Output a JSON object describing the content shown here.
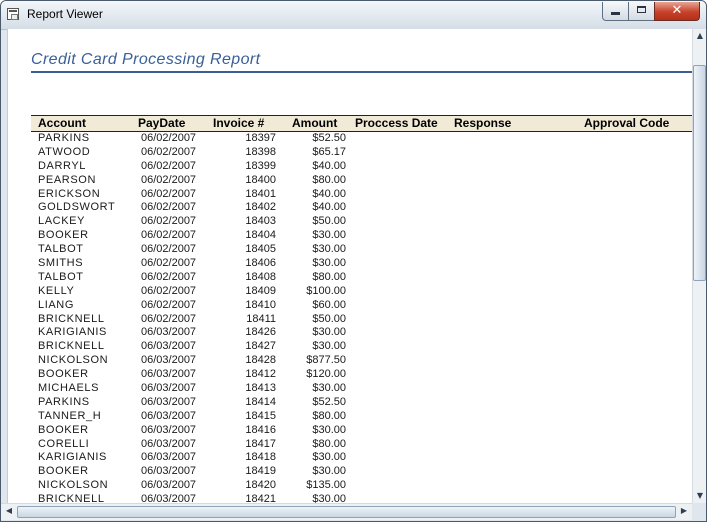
{
  "window": {
    "title": "Report Viewer"
  },
  "report": {
    "title": "Credit Card Processing Report",
    "columns": {
      "account": "Account",
      "paydate": "PayDate",
      "invoice": "Invoice #",
      "amount": "Amount",
      "process_date": "Proccess Date",
      "response": "Response",
      "approval": "Approval Code"
    },
    "rows": [
      [
        "PARKINS",
        "06/02/2007",
        "18397",
        "$52.50"
      ],
      [
        "ATWOOD",
        "06/02/2007",
        "18398",
        "$65.17"
      ],
      [
        "DARRYL",
        "06/02/2007",
        "18399",
        "$40.00"
      ],
      [
        "PEARSON",
        "06/02/2007",
        "18400",
        "$80.00"
      ],
      [
        "ERICKSON",
        "06/02/2007",
        "18401",
        "$40.00"
      ],
      [
        "GOLDSWORT",
        "06/02/2007",
        "18402",
        "$40.00"
      ],
      [
        "LACKEY",
        "06/02/2007",
        "18403",
        "$50.00"
      ],
      [
        "BOOKER",
        "06/02/2007",
        "18404",
        "$30.00"
      ],
      [
        "TALBOT",
        "06/02/2007",
        "18405",
        "$30.00"
      ],
      [
        "SMITHS",
        "06/02/2007",
        "18406",
        "$30.00"
      ],
      [
        "TALBOT",
        "06/02/2007",
        "18408",
        "$80.00"
      ],
      [
        "KELLY",
        "06/02/2007",
        "18409",
        "$100.00"
      ],
      [
        "LIANG",
        "06/02/2007",
        "18410",
        "$60.00"
      ],
      [
        "BRICKNELL",
        "06/02/2007",
        "18411",
        "$50.00"
      ],
      [
        "KARIGIANIS",
        "06/03/2007",
        "18426",
        "$30.00"
      ],
      [
        "BRICKNELL",
        "06/03/2007",
        "18427",
        "$30.00"
      ],
      [
        "NICKOLSON",
        "06/03/2007",
        "18428",
        "$877.50"
      ],
      [
        "BOOKER",
        "06/03/2007",
        "18412",
        "$120.00"
      ],
      [
        "MICHAELS",
        "06/03/2007",
        "18413",
        "$30.00"
      ],
      [
        "PARKINS",
        "06/03/2007",
        "18414",
        "$52.50"
      ],
      [
        "TANNER_H",
        "06/03/2007",
        "18415",
        "$80.00"
      ],
      [
        "BOOKER",
        "06/03/2007",
        "18416",
        "$30.00"
      ],
      [
        "CORELLI",
        "06/03/2007",
        "18417",
        "$80.00"
      ],
      [
        "KARIGIANIS",
        "06/03/2007",
        "18418",
        "$30.00"
      ],
      [
        "BOOKER",
        "06/03/2007",
        "18419",
        "$30.00"
      ],
      [
        "NICKOLSON",
        "06/03/2007",
        "18420",
        "$135.00"
      ],
      [
        "BRICKNELL",
        "06/03/2007",
        "18421",
        "$30.00"
      ]
    ]
  },
  "icons": {
    "app": "report-window-icon",
    "minimize": "minimize-icon",
    "maximize": "maximize-icon",
    "close": "close-icon"
  },
  "colors": {
    "title": "#3a5f97",
    "header_band": "#f1ead6"
  }
}
